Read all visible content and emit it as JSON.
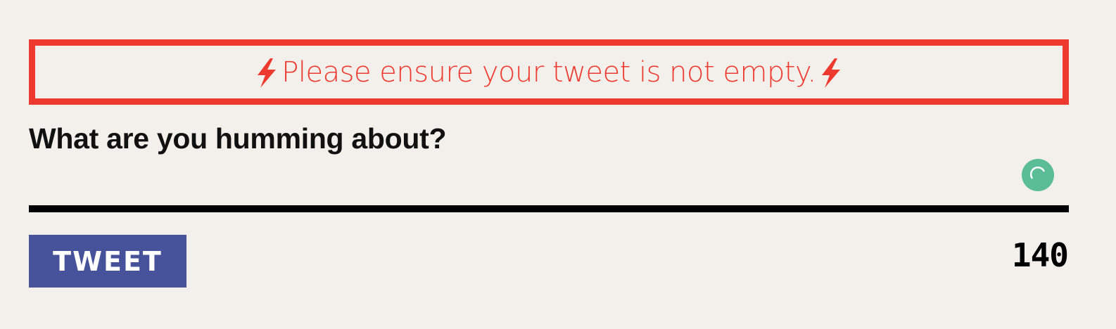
{
  "error": {
    "message": "Please ensure your tweet is not empty.",
    "color": "#ee3a2e",
    "leading_icon": "lightning-bolt-icon",
    "trailing_icon": "lightning-bolt-icon"
  },
  "composer": {
    "prompt": "What are you humming about?",
    "input_value": "",
    "spinner_icon": "loading-spinner-icon",
    "spinner_color": "#5bbd96"
  },
  "actions": {
    "tweet_label": "TWEET",
    "tweet_color": "#46529a",
    "char_count": "140"
  }
}
